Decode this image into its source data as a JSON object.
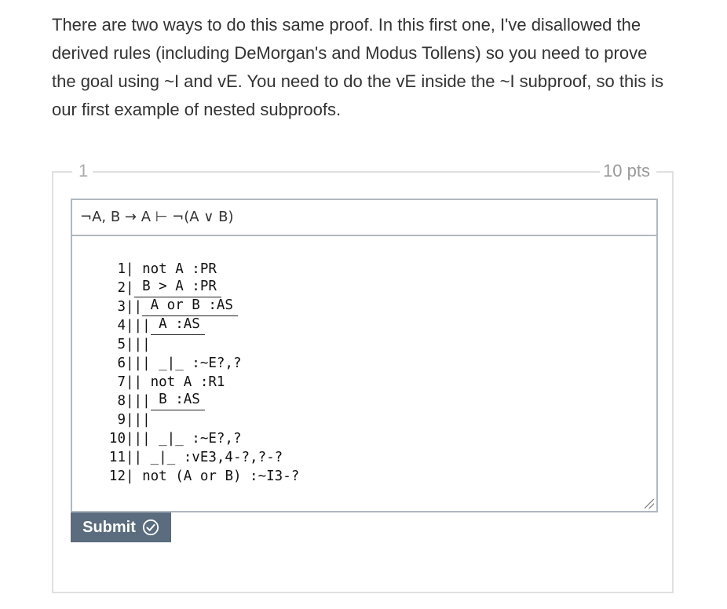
{
  "intro_text": "There are two ways to do this same proof. In this first one, I've disallowed the derived rules (including DeMorgan's and Modus Tollens) so you need to prove the goal using ~I and vE. You need to do the vE inside the ~I subproof, so this is our first example of nested subproofs.",
  "question": {
    "number": "1",
    "points": "10 pts",
    "goal": "¬A, B → A ⊢ ¬(A ∨ B)",
    "proof_lines": [
      {
        "n": "1",
        "bars": "|",
        "text": " not A :PR"
      },
      {
        "n": "2",
        "bars": "|",
        "text": " B > A :PR"
      },
      {
        "n": "3",
        "bars": "||",
        "text": " A or B :AS"
      },
      {
        "n": "4",
        "bars": "|||",
        "text": " A :AS"
      },
      {
        "n": "5",
        "bars": "|||",
        "text": ""
      },
      {
        "n": "6",
        "bars": "|||",
        "text": " _|_ :~E?,?"
      },
      {
        "n": "7",
        "bars": "||",
        "text": " not A :R1"
      },
      {
        "n": "8",
        "bars": "|||",
        "text": " B :AS"
      },
      {
        "n": "9",
        "bars": "|||",
        "text": ""
      },
      {
        "n": "10",
        "bars": "|||",
        "text": " _|_ :~E?,?"
      },
      {
        "n": "11",
        "bars": "||",
        "text": " _|_ :vE3,4-?,?-?"
      },
      {
        "n": "12",
        "bars": "|",
        "text": " not (A or B) :~I3-?"
      }
    ],
    "submit_label": "Submit"
  }
}
